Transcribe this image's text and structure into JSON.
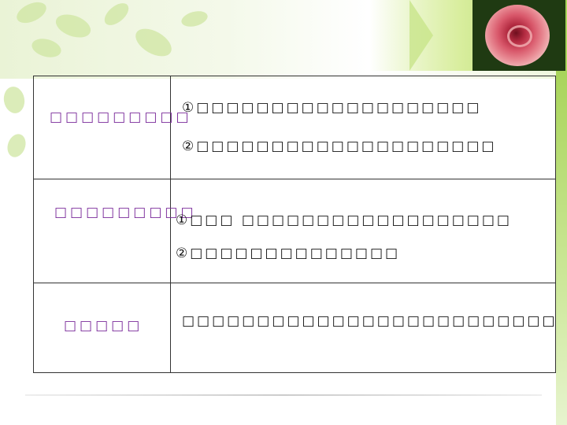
{
  "slide": {
    "rows": [
      {
        "label": "□□□□□□□□□",
        "items": [
          "①□□□□□□□□□□□□□□□□□□□",
          "②□□□□□□□□□□□□□□□□□□□□"
        ]
      },
      {
        "label": "□□□□□□□□□",
        "items": [
          "①□□□ □□□□□□□□□□□□□□□□□□",
          "②□□□□□□□□□□□□□□"
        ]
      },
      {
        "label": "□□□□□",
        "items": [
          "□□□□□□□□□□□□□□□□□□□□□□□□□"
        ]
      }
    ]
  },
  "colors": {
    "label": "#7a2a9a",
    "accent_green": "#a8d45a",
    "border": "#333333"
  },
  "icons": {
    "decoration": "rose-photo"
  }
}
